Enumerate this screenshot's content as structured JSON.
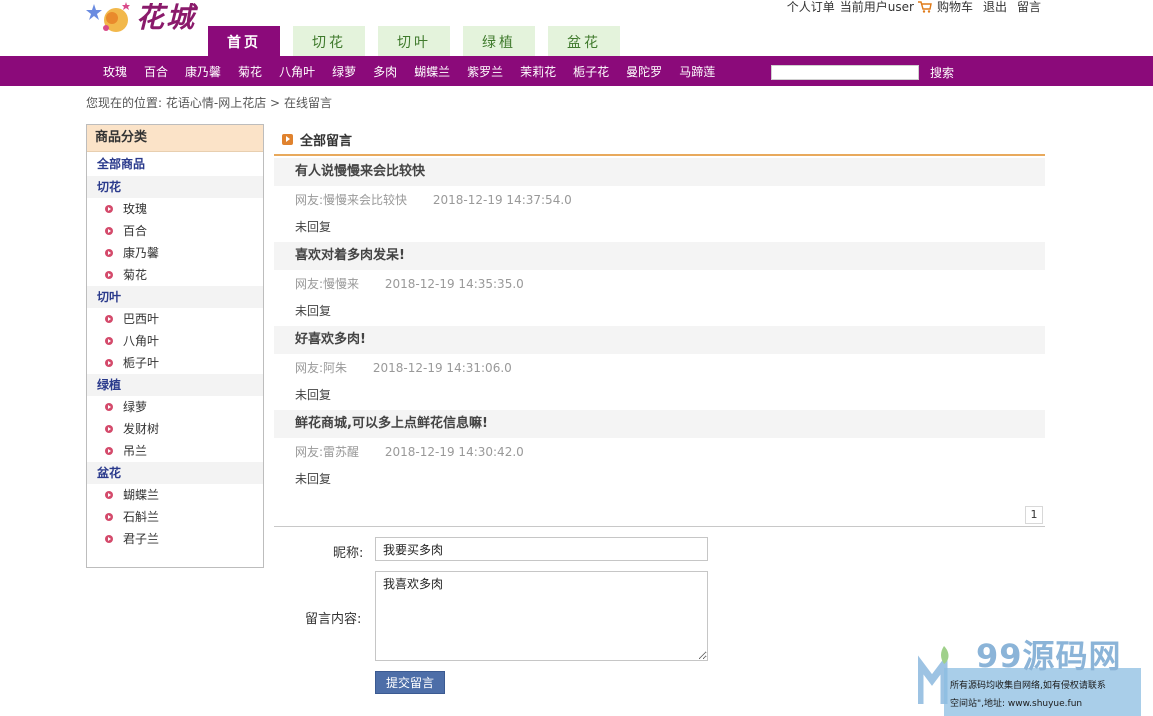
{
  "header": {
    "logo_text": "花城",
    "tabs": [
      {
        "label": "首页"
      },
      {
        "label": "切花"
      },
      {
        "label": "切叶"
      },
      {
        "label": "绿植"
      },
      {
        "label": "盆花"
      }
    ],
    "links": {
      "orders": "个人订单",
      "current_user": "当前用户user",
      "cart": "购物车",
      "logout": "退出",
      "message": "留言"
    }
  },
  "nav": {
    "links": [
      "玫瑰",
      "百合",
      "康乃馨",
      "菊花",
      "八角叶",
      "绿萝",
      "多肉",
      "蝴蝶兰",
      "紫罗兰",
      "茉莉花",
      "栀子花",
      "曼陀罗",
      "马蹄莲"
    ],
    "search_value": "",
    "search_button": "搜索"
  },
  "breadcrumb": {
    "prefix": "您现在的位置:",
    "home": "花语心情-网上花店",
    "separator": ">",
    "current": "在线留言"
  },
  "sidebar": {
    "title": "商品分类",
    "all": "全部商品",
    "categories": [
      {
        "name": "切花",
        "items": [
          "玫瑰",
          "百合",
          "康乃馨",
          "菊花"
        ]
      },
      {
        "name": "切叶",
        "items": [
          "巴西叶",
          "八角叶",
          "栀子叶"
        ]
      },
      {
        "name": "绿植",
        "items": [
          "绿萝",
          "发财树",
          "吊兰"
        ]
      },
      {
        "name": "盆花",
        "items": [
          "蝴蝶兰",
          "石斛兰",
          "君子兰"
        ]
      }
    ]
  },
  "main": {
    "title": "全部留言",
    "messages": [
      {
        "title": "有人说慢慢来会比较快",
        "author": "网友:慢慢来会比较快",
        "time": "2018-12-19 14:37:54.0",
        "reply": "未回复"
      },
      {
        "title": "喜欢对着多肉发呆!",
        "author": "网友:慢慢来",
        "time": "2018-12-19 14:35:35.0",
        "reply": "未回复"
      },
      {
        "title": "好喜欢多肉!",
        "author": "网友:阿朱",
        "time": "2018-12-19 14:31:06.0",
        "reply": "未回复"
      },
      {
        "title": "鲜花商城,可以多上点鲜花信息嘛!",
        "author": "网友:雷苏醒",
        "time": "2018-12-19 14:30:42.0",
        "reply": "未回复"
      }
    ],
    "page": "1"
  },
  "form": {
    "nickname_label": "昵称:",
    "nickname_value": "我要买多肉",
    "content_label": "留言内容:",
    "content_value": "我喜欢多肉",
    "submit": "提交留言"
  },
  "watermark": {
    "brand": "99源码网",
    "line1": "所有源码均收集自网络,如有侵权请联系",
    "line2": "空间站\",地址: www.shuyue.fun"
  },
  "colors": {
    "brand_purple": "#8b0a7a",
    "tab_green": "#e4f3dc",
    "accent_orange": "#e8a95c",
    "submit_blue": "#4d6ea8"
  }
}
